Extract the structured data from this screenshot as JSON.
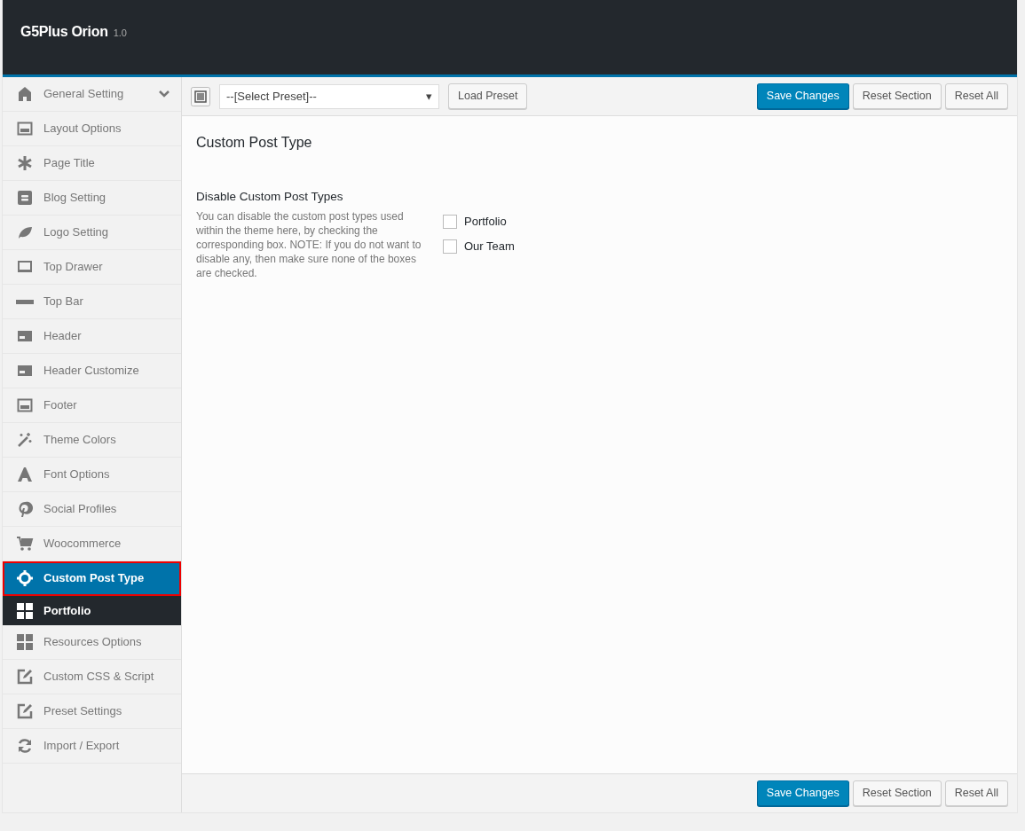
{
  "header": {
    "title": "G5Plus Orion",
    "version": "1.0"
  },
  "sidebar": {
    "items": [
      {
        "label": "General Setting",
        "selected": false,
        "chevron": true
      },
      {
        "label": "Layout Options",
        "selected": false,
        "chevron": false
      },
      {
        "label": "Page Title",
        "selected": false,
        "chevron": false
      },
      {
        "label": "Blog Setting",
        "selected": false,
        "chevron": false
      },
      {
        "label": "Logo Setting",
        "selected": false,
        "chevron": false
      },
      {
        "label": "Top Drawer",
        "selected": false,
        "chevron": false
      },
      {
        "label": "Top Bar",
        "selected": false,
        "chevron": false
      },
      {
        "label": "Header",
        "selected": false,
        "chevron": false
      },
      {
        "label": "Header Customize",
        "selected": false,
        "chevron": false
      },
      {
        "label": "Footer",
        "selected": false,
        "chevron": false
      },
      {
        "label": "Theme Colors",
        "selected": false,
        "chevron": false
      },
      {
        "label": "Font Options",
        "selected": false,
        "chevron": false
      },
      {
        "label": "Social Profiles",
        "selected": false,
        "chevron": false
      },
      {
        "label": "Woocommerce",
        "selected": false,
        "chevron": false
      },
      {
        "label": "Custom Post Type",
        "selected": true,
        "chevron": false,
        "children": [
          {
            "label": "Portfolio",
            "selected": true
          }
        ]
      },
      {
        "label": "Resources Options",
        "selected": false,
        "chevron": false
      },
      {
        "label": "Custom CSS & Script",
        "selected": false,
        "chevron": false
      },
      {
        "label": "Preset Settings",
        "selected": false,
        "chevron": false
      },
      {
        "label": "Import / Export",
        "selected": false,
        "chevron": false
      }
    ]
  },
  "toolbar": {
    "preset_select": "--[Select Preset]--",
    "preset_arrow": "▾",
    "load_button": "Load Preset",
    "buttons": [
      {
        "label": "Save Changes",
        "kind": "primary"
      },
      {
        "label": "Reset Section",
        "kind": "secondary"
      },
      {
        "label": "Reset All",
        "kind": "secondary"
      }
    ]
  },
  "section": {
    "title": "Custom Post Type",
    "field": {
      "title": "Disable Custom Post Types",
      "description": "You can disable the custom post types used within the theme here, by checking the corresponding box. NOTE: If you do not want to disable any, then make sure none of the boxes are checked.",
      "options": [
        {
          "label": "Portfolio",
          "checked": false
        },
        {
          "label": "Our Team",
          "checked": false
        }
      ]
    }
  },
  "footer": {
    "buttons": [
      {
        "label": "Save Changes",
        "kind": "primary"
      },
      {
        "label": "Reset Section",
        "kind": "secondary"
      },
      {
        "label": "Reset All",
        "kind": "secondary"
      }
    ]
  }
}
